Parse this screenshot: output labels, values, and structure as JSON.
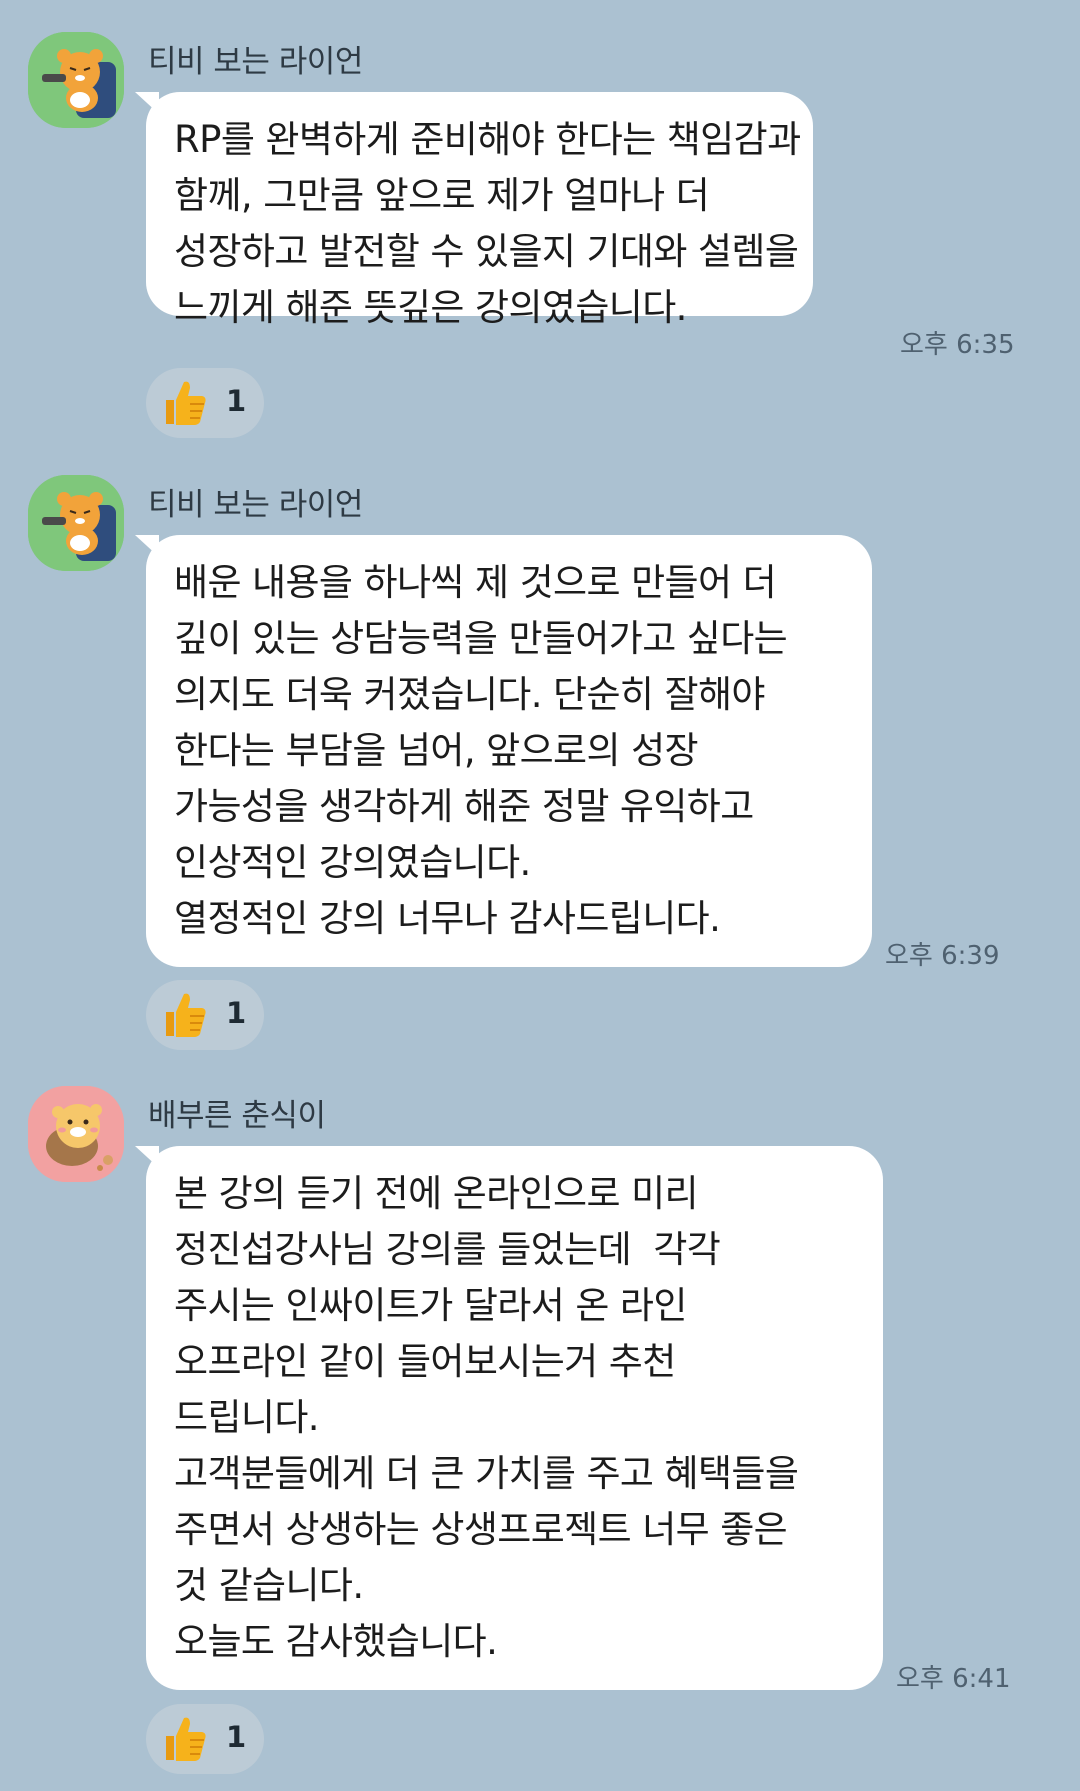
{
  "messages": [
    {
      "sender": "티비 보는 라이언",
      "avatar_icon": "ryan-watching-tv-avatar",
      "avatar_bg": "#7fc77b",
      "lines": [
        "RP를 완벽하게 준비해야 한다는 책임감과",
        "함께, 그만큼 앞으로 제가 얼마나 더",
        "성장하고 발전할 수 있을지 기대와 설렘을",
        "느끼게 해준 뜻깊은 강의였습니다."
      ],
      "time": "오후 6:35",
      "reaction": {
        "icon": "thumbs-up-icon",
        "count": "1"
      }
    },
    {
      "sender": "티비 보는 라이언",
      "avatar_icon": "ryan-watching-tv-avatar",
      "avatar_bg": "#7fc77b",
      "lines": [
        "배운 내용을 하나씩 제 것으로 만들어 더",
        "깊이 있는 상담능력을 만들어가고 싶다는",
        "의지도 더욱 커졌습니다. 단순히 잘해야",
        "한다는 부담을 넘어, 앞으로의 성장",
        "가능성을 생각하게 해준 정말 유익하고",
        "인상적인 강의였습니다.",
        "열정적인 강의 너무나 감사드립니다."
      ],
      "time": "오후 6:39",
      "reaction": {
        "icon": "thumbs-up-icon",
        "count": "1"
      }
    },
    {
      "sender": "배부른 춘식이",
      "avatar_icon": "full-choonsik-avatar",
      "avatar_bg": "#f2a1a1",
      "lines": [
        "본 강의 듣기 전에 온라인으로 미리",
        "정진섭강사님 강의를 들었는데  각각",
        "주시는 인싸이트가 달라서 온 라인",
        "오프라인 같이 들어보시는거 추천",
        "드립니다.",
        "고객분들에게 더 큰 가치를 주고 혜택들을",
        "주면서 상생하는 상생프로젝트 너무 좋은",
        "것 같습니다.",
        "오늘도 감사했습니다."
      ],
      "time": "오후 6:41",
      "reaction": {
        "icon": "thumbs-up-icon",
        "count": "1"
      }
    }
  ],
  "colors": {
    "background": "#abc1d1",
    "bubble": "#ffffff",
    "reaction_pill": "#bccbd6",
    "thumb": "#f6b21b"
  }
}
